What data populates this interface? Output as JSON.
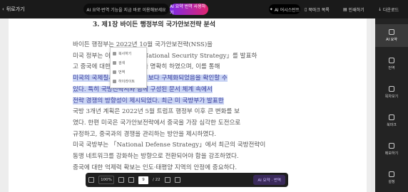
{
  "topbar": {
    "back_label": "뒤로가기",
    "center_pill": "AI 요약·번역 기능을 지금 바로 이용해보세요",
    "gradient_pill": "AI 요약 번역 사용하기",
    "ai_button": "AI 어시스턴트",
    "right_items": [
      "북마크 목록",
      "인쇄하기",
      "다운로드"
    ]
  },
  "document": {
    "title": "3. 제1장 바이든 행정부의 국가안보전략 분석",
    "lines": [
      "바이든 행정부는 2022년 10월 국가안보전략(NSS)을",
      "미국 정부는 이와 연관된 「National Security Strategy」를 발표하",
      "고 중국에 대한 경쟁적 접근을 명확히 하였으며, 이를 통해",
      "미국의 국제질서 유지 전략이 보다 구체화되었음을 확인할 수",
      "있다. 특히 국방전략서와 함께 구성된 문서 체계 속에서",
      "전략 경쟁의 방향성이 제시되었다. 최근 미 국방부가 발표한",
      "국방 3개년 계획은 2022년 5월 트럼프 행정부 이후 큰 변화를 보",
      "였다. 한편 미국은 국가안보전략에서 중국을 가장 심각한 도전으로",
      "규정하고, 중국과의 경쟁을 관리하는 방안을 제시하였다.",
      "미국 국방부는 「National Defense Strategy」에서 최근의 국방전략이",
      "동맹 네트워크를 강화하는 방향으로 전환되어야 함을 강조하였다.",
      "중국에 대한 억제력 확보는 인도·태평양 지역의 안정에 중요하다."
    ]
  },
  "context_menu": {
    "items": [
      "복사하기",
      "검색",
      "번역",
      "하이라이트"
    ]
  },
  "sidebar": {
    "items": [
      "AI 요약",
      "번역",
      "목차보기",
      "북마크",
      "메모하기",
      "설정"
    ]
  },
  "bottombar": {
    "zoom": "100%",
    "page_current": "9",
    "page_total": "/ 22",
    "purple_button": "AI 요약 · 번역"
  }
}
